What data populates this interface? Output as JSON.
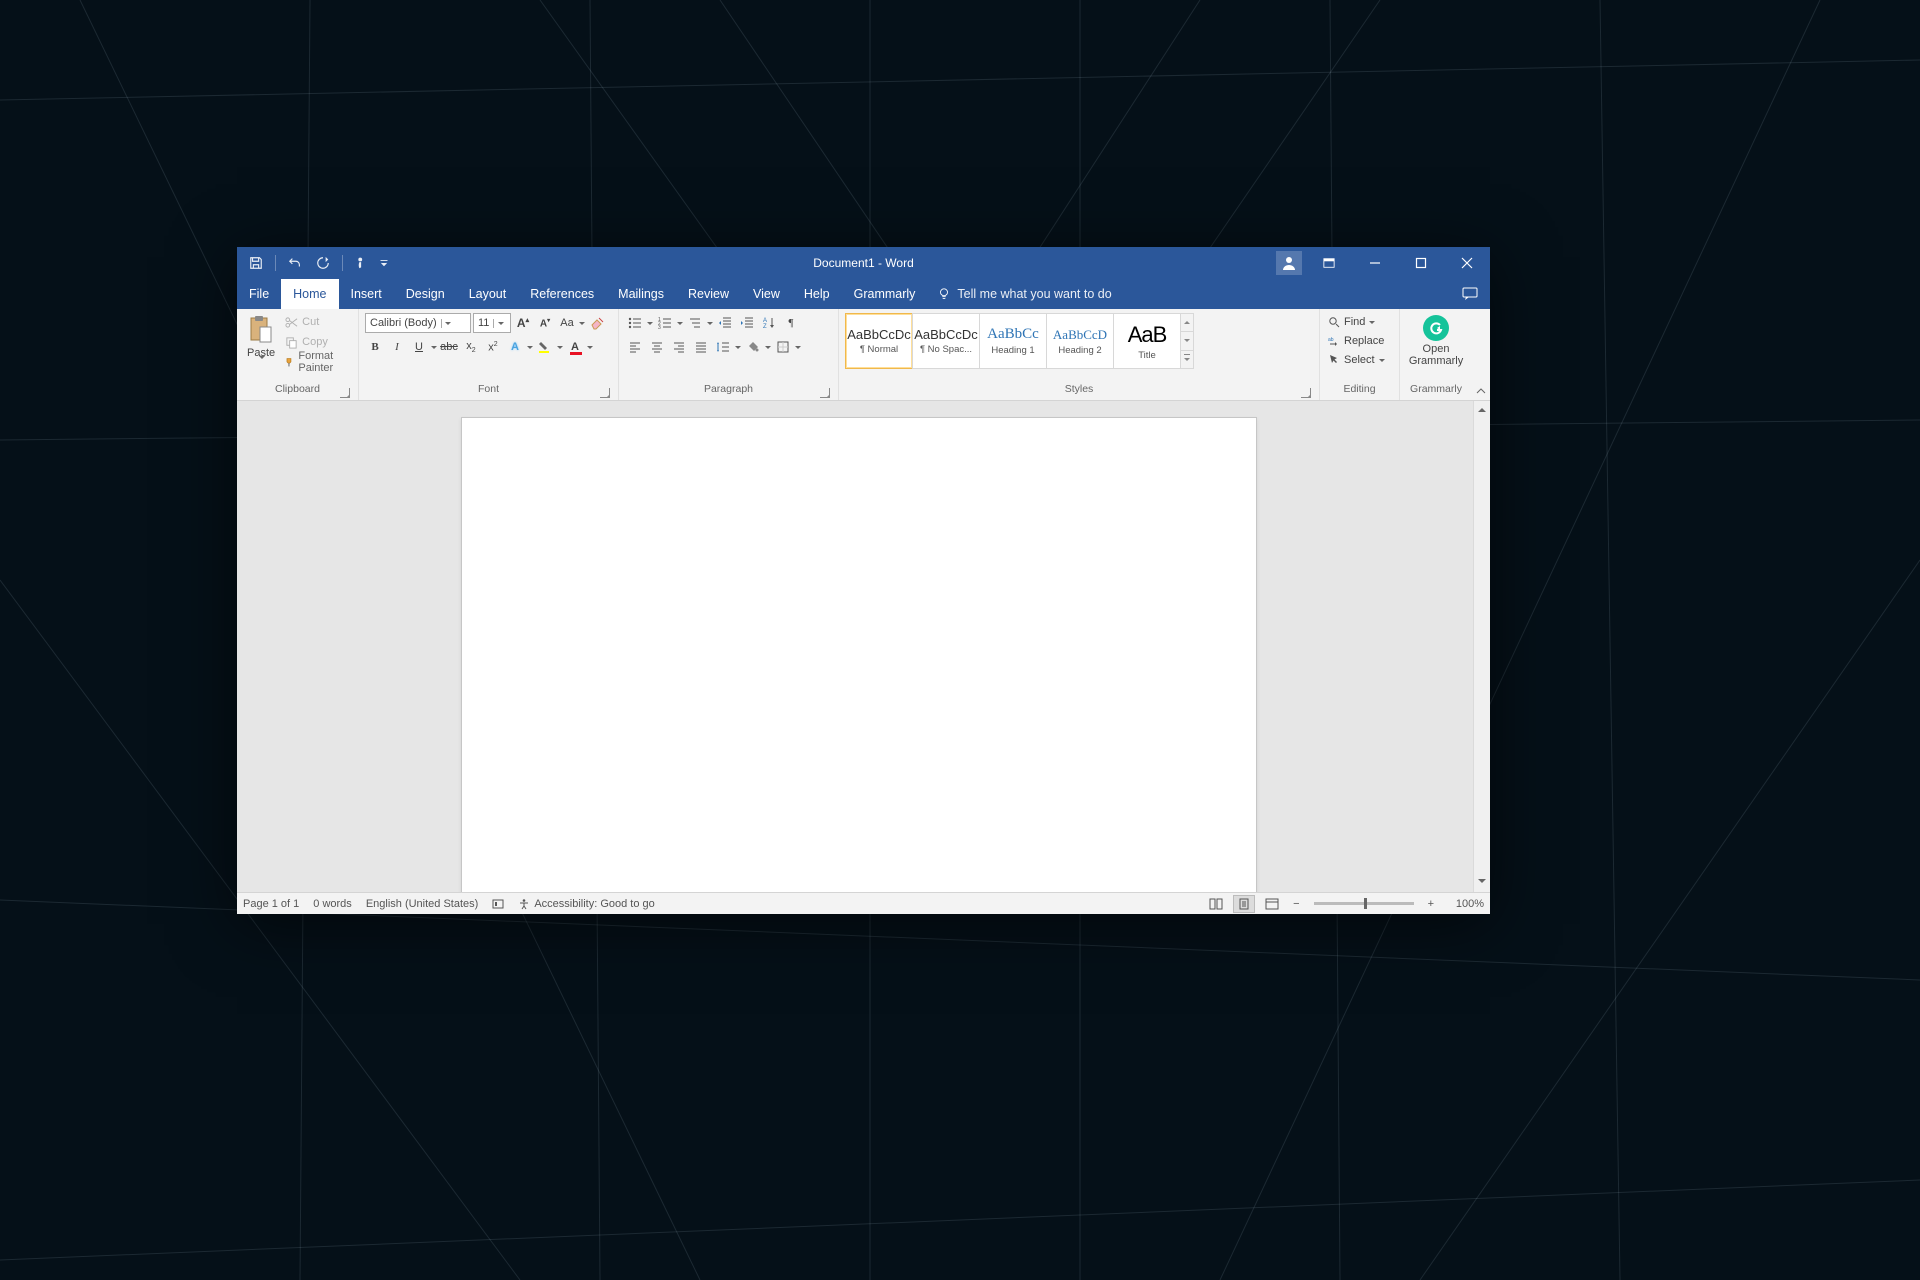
{
  "title": "Document1 - Word",
  "tabs": {
    "file": "File",
    "home": "Home",
    "insert": "Insert",
    "design": "Design",
    "layout": "Layout",
    "references": "References",
    "mailings": "Mailings",
    "review": "Review",
    "view": "View",
    "help": "Help",
    "grammarly": "Grammarly"
  },
  "tellme": "Tell me what you want to do",
  "clipboard": {
    "paste": "Paste",
    "cut": "Cut",
    "copy": "Copy",
    "format_painter": "Format Painter",
    "label": "Clipboard"
  },
  "font": {
    "name": "Calibri (Body)",
    "size": "11",
    "label": "Font"
  },
  "paragraph": {
    "label": "Paragraph"
  },
  "styles": {
    "label": "Styles",
    "items": [
      {
        "preview": "AaBbCcDc",
        "name": "¶ Normal",
        "cls": ""
      },
      {
        "preview": "AaBbCcDc",
        "name": "¶ No Spac...",
        "cls": ""
      },
      {
        "preview": "AaBbCc",
        "name": "Heading 1",
        "cls": "blue"
      },
      {
        "preview": "AaBbCcD",
        "name": "Heading 2",
        "cls": "blue"
      },
      {
        "preview": "AaB",
        "name": "Title",
        "cls": "title"
      }
    ]
  },
  "editing": {
    "find": "Find",
    "replace": "Replace",
    "select": "Select",
    "label": "Editing"
  },
  "grammarly_group": {
    "open": "Open",
    "sub": "Grammarly",
    "label": "Grammarly"
  },
  "status": {
    "page": "Page 1 of 1",
    "words": "0 words",
    "lang": "English (United States)",
    "accessibility": "Accessibility: Good to go",
    "zoom": "100%"
  }
}
